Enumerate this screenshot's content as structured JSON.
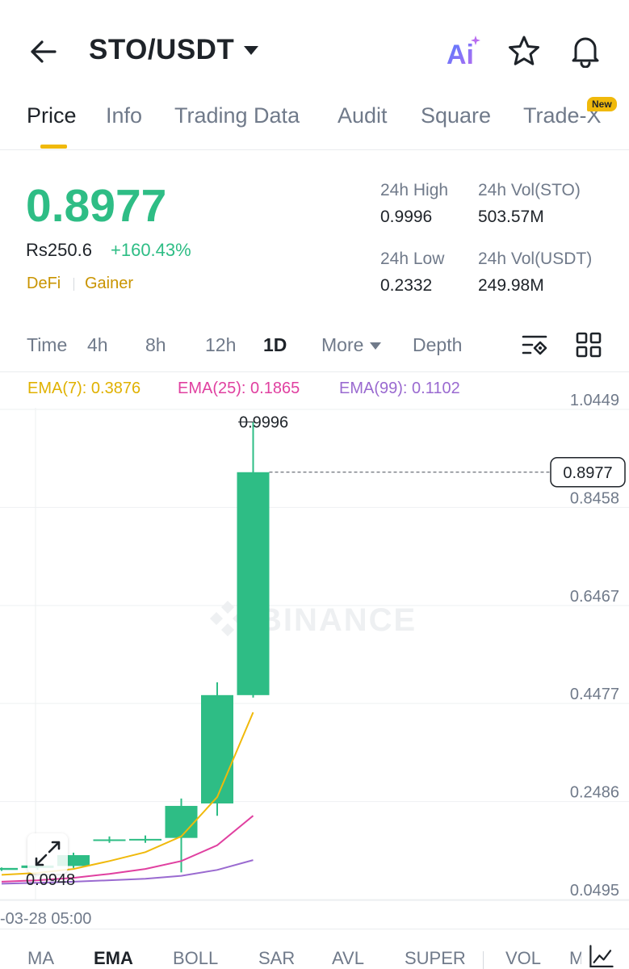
{
  "header": {
    "pair": "STO/USDT",
    "ai_label": "Ai"
  },
  "tabs": [
    {
      "label": "Price",
      "active": true
    },
    {
      "label": "Info"
    },
    {
      "label": "Trading Data"
    },
    {
      "label": "Audit"
    },
    {
      "label": "Square"
    },
    {
      "label": "Trade-X",
      "badge": "New"
    }
  ],
  "ticker": {
    "price": "0.8977",
    "fiat": "Rs250.6",
    "change": "+160.43%",
    "tags": [
      "DeFi",
      "Gainer"
    ],
    "stats": {
      "high_label": "24h High",
      "high": "0.9996",
      "low_label": "24h Low",
      "low": "0.2332",
      "vol_base_label": "24h Vol(STO)",
      "vol_base": "503.57M",
      "vol_quote_label": "24h Vol(USDT)",
      "vol_quote": "249.98M"
    }
  },
  "timeframes": [
    {
      "label": "Time"
    },
    {
      "label": "4h"
    },
    {
      "label": "8h"
    },
    {
      "label": "12h"
    },
    {
      "label": "1D",
      "active": true
    },
    {
      "label": "More"
    },
    {
      "label": "Depth"
    }
  ],
  "ema": {
    "ema7": "EMA(7): 0.3876",
    "ema25": "EMA(25): 0.1865",
    "ema99": "EMA(99): 0.1102"
  },
  "colors": {
    "up": "#2ebd85",
    "accent": "#f0b90b",
    "ema7": "#f0b90b",
    "ema25": "#e040a0",
    "ema99": "#9a6ad0",
    "tag": "#c99400"
  },
  "chart_data": {
    "type": "candlestick",
    "y_ticks": [
      "1.0449",
      "0.8458",
      "0.6467",
      "0.4477",
      "0.2486",
      "0.0495"
    ],
    "ylim": [
      0.0495,
      1.0449
    ],
    "x_label": "-03-28 05:00",
    "high_marker": "0.9996",
    "low_marker": "0.0948",
    "current_price": "0.8977",
    "watermark": "BINANCE",
    "candles": [
      {
        "open": 0.09,
        "close": 0.094,
        "high": 0.095,
        "low": 0.088
      },
      {
        "open": 0.094,
        "close": 0.099,
        "high": 0.101,
        "low": 0.09
      },
      {
        "open": 0.098,
        "close": 0.12,
        "high": 0.125,
        "low": 0.094
      },
      {
        "open": 0.15,
        "close": 0.152,
        "high": 0.158,
        "low": 0.145
      },
      {
        "open": 0.15,
        "close": 0.153,
        "high": 0.16,
        "low": 0.145
      },
      {
        "open": 0.155,
        "close": 0.22,
        "high": 0.235,
        "low": 0.085
      },
      {
        "open": 0.225,
        "close": 0.445,
        "high": 0.471,
        "low": 0.2
      },
      {
        "open": 0.445,
        "close": 0.8977,
        "high": 0.9996,
        "low": 0.44
      }
    ],
    "ema7": [
      0.08,
      0.084,
      0.092,
      0.108,
      0.126,
      0.158,
      0.238,
      0.41
    ],
    "ema25": [
      0.066,
      0.069,
      0.074,
      0.082,
      0.092,
      0.108,
      0.14,
      0.2
    ],
    "ema99": [
      0.062,
      0.064,
      0.066,
      0.069,
      0.072,
      0.078,
      0.09,
      0.11
    ]
  },
  "indicators": [
    {
      "label": "MA"
    },
    {
      "label": "EMA",
      "active": true
    },
    {
      "label": "BOLL"
    },
    {
      "label": "SAR"
    },
    {
      "label": "AVL"
    },
    {
      "label": "SUPER"
    },
    {
      "label": "VOL"
    },
    {
      "label": "M"
    }
  ]
}
